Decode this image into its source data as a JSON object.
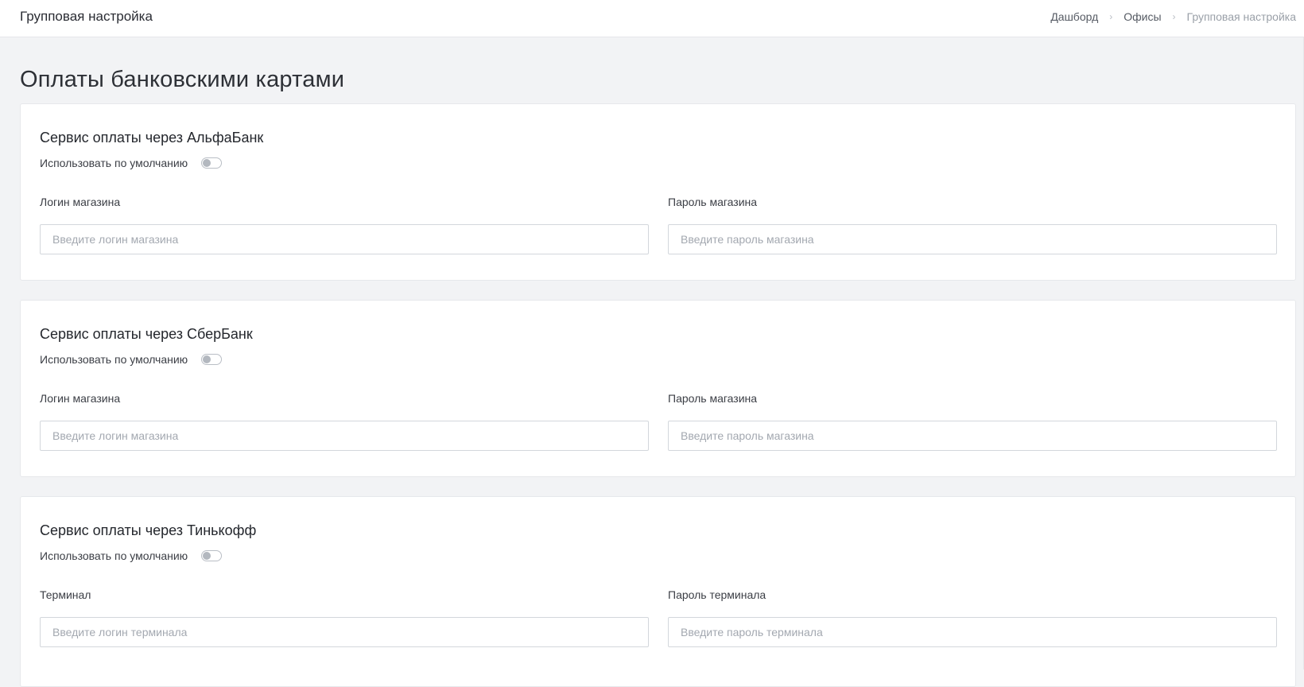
{
  "header": {
    "title": "Групповая настройка",
    "breadcrumb": [
      {
        "label": "Дашборд"
      },
      {
        "label": "Офисы"
      },
      {
        "label": "Групповая настройка"
      }
    ],
    "separator": "›"
  },
  "page": {
    "title": "Оплаты банковскими картами"
  },
  "cards": {
    "alfa": {
      "title": "Сервис оплаты через АльфаБанк",
      "default_label": "Использовать по умолчанию",
      "default_enabled": false,
      "login_label": "Логин магазина",
      "login_value": "",
      "login_placeholder": "Введите логин магазина",
      "password_label": "Пароль магазина",
      "password_value": "",
      "password_placeholder": "Введите пароль магазина"
    },
    "sber": {
      "title": "Сервис оплаты через СберБанк",
      "default_label": "Использовать по умолчанию",
      "default_enabled": false,
      "login_label": "Логин магазина",
      "login_value": "",
      "login_placeholder": "Введите логин магазина",
      "password_label": "Пароль магазина",
      "password_value": "",
      "password_placeholder": "Введите пароль магазина"
    },
    "tinkoff": {
      "title": "Сервис оплаты через Тинькофф",
      "default_label": "Использовать по умолчанию",
      "default_enabled": false,
      "login_label": "Терминал",
      "login_value": "",
      "login_placeholder": "Введите логин терминала",
      "password_label": "Пароль терминала",
      "password_value": "",
      "password_placeholder": "Введите пароль терминала"
    }
  },
  "colors": {
    "page_background": "#f2f3f5",
    "card_background": "#ffffff",
    "border": "#d3d7dc",
    "toggle_off": "#b3b8bf",
    "placeholder": "#a3a8b0"
  },
  "icons": {
    "breadcrumb_separator": "chevron-right-icon"
  }
}
